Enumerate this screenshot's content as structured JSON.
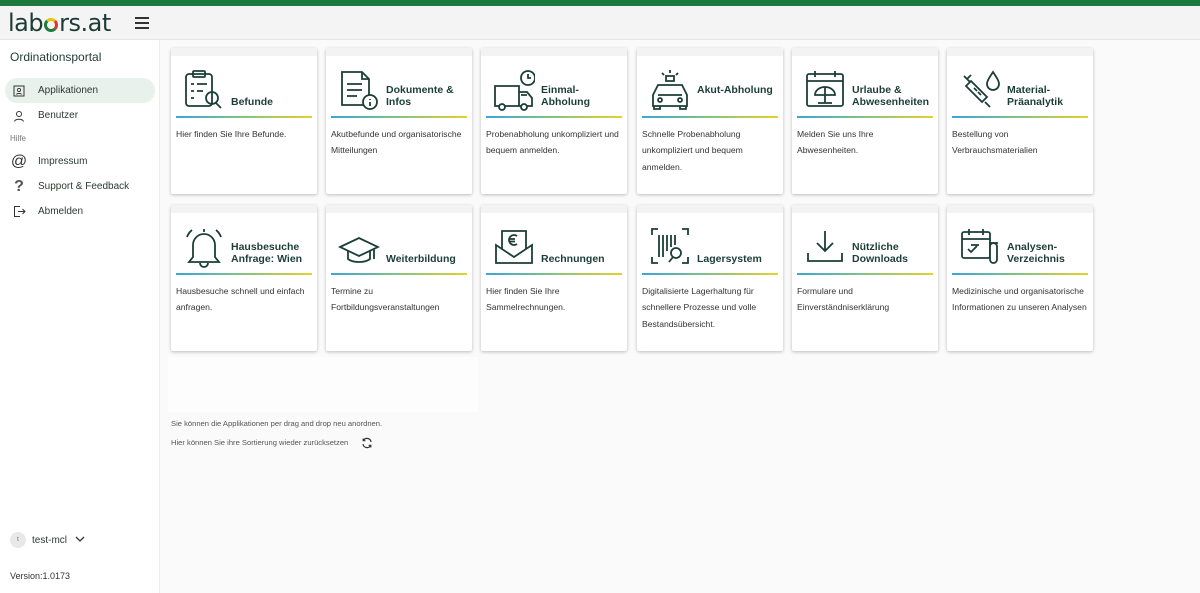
{
  "brand": {
    "logo_pre": "lab",
    "logo_post": "rs.at"
  },
  "sidebar": {
    "portal_title": "Ordinationsportal",
    "items": [
      {
        "label": "Applikationen",
        "icon": "applications-icon"
      },
      {
        "label": "Benutzer",
        "icon": "user-icon"
      }
    ],
    "section_hilfe": "Hilfe",
    "help_items": [
      {
        "label": "Impressum",
        "icon": "at-icon"
      },
      {
        "label": "Support & Feedback",
        "icon": "question-icon"
      },
      {
        "label": "Abmelden",
        "icon": "logout-icon"
      }
    ],
    "user": {
      "avatar": "t",
      "name": "test-mcl"
    },
    "version": "Version:1.0173"
  },
  "cards": [
    {
      "title": "Befunde",
      "desc": "Hier finden Sie Ihre Befunde.",
      "icon": "clipboard-search-icon"
    },
    {
      "title": "Dokumente & Infos",
      "desc": "Akutbefunde und organisatorische Mitteilungen",
      "icon": "document-info-icon"
    },
    {
      "title": "Einmal-Abholung",
      "desc": "Probenabholung unkompliziert und bequem anmelden.",
      "icon": "van-clock-icon"
    },
    {
      "title": "Akut-Abholung",
      "desc": "Schnelle Probenabholung unkompliziert und bequem anmelden.",
      "icon": "car-siren-icon"
    },
    {
      "title": "Urlaube & Abwesenheiten",
      "desc": "Melden Sie uns Ihre Abwesenheiten.",
      "icon": "calendar-beach-icon"
    },
    {
      "title": "Material-Präanalytik",
      "desc": "Bestellung von Verbrauchsmaterialien",
      "icon": "syringe-drop-icon"
    },
    {
      "title": "Hausbesuche Anfrage: Wien",
      "desc": "Hausbesuche schnell und einfach anfragen.",
      "icon": "bell-icon"
    },
    {
      "title": "Weiterbildung",
      "desc": "Termine zu Fortbildungsveranstaltungen",
      "icon": "graduation-cap-icon"
    },
    {
      "title": "Rechnungen",
      "desc": "Hier finden Sie Ihre Sammelrechnungen.",
      "icon": "envelope-euro-icon"
    },
    {
      "title": "Lagersystem",
      "desc": "Digitalisierte Lagerhaltung für schnellere Prozesse und volle Bestandsübersicht.",
      "icon": "barcode-scan-icon"
    },
    {
      "title": "Nützliche Downloads",
      "desc": "Formulare und Einverständniserklärung",
      "icon": "download-icon"
    },
    {
      "title": "Analysen-Verzeichnis",
      "desc": "Medizinische und organisatorische Informationen zu unseren Analysen",
      "icon": "calendar-tube-icon"
    }
  ],
  "info": {
    "drag_hint": "Sie können die Applikationen per drag and drop neu anordnen.",
    "reset_hint": "Hier können Sie ihre Sortierung wieder zurücksetzen"
  },
  "colors": {
    "brand_green": "#1d7a3c",
    "bar_gradient": [
      "#3aa6d6",
      "#7cc18a",
      "#e5d12c"
    ]
  }
}
